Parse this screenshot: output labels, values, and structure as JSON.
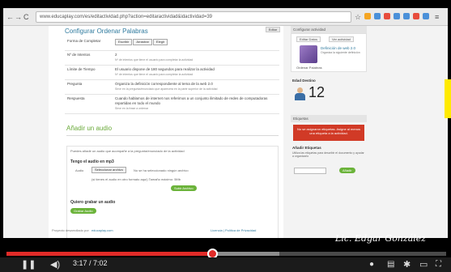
{
  "browser": {
    "url": "www.educaplay.com/es/editactividad.php?action=editaractividad&idactividad=39",
    "ext_colors": [
      "#f5a623",
      "#4a90d9",
      "#e74c3c",
      "#4a90d9",
      "#4a90d9",
      "#e74c3c",
      "#4a90d9"
    ]
  },
  "main": {
    "title": "Configurar Ordenar Palabras",
    "top_button": "Editar",
    "rows": [
      {
        "label": "Forma de Completar",
        "buttons": [
          "Escribir",
          "Arrastrar",
          "Elegir"
        ],
        "hint": ""
      },
      {
        "label": "Nº de Intentos",
        "value": "2",
        "hint": "Nº de intentos que tiene el usuario para completar la actividad"
      },
      {
        "label": "Límite de Tiempo",
        "value": "El usuario dispone de 180 segundos para realizar la actividad",
        "hint": "Nº de intentos que tiene el usuario para completar la actividad"
      },
      {
        "label": "Pregunta",
        "value": "Organiza la definición correspondiente al tema de la web 2.0",
        "hint": "Sirve en la pregunta/enunciado que aparecerá en la parte superior de la actividad"
      },
      {
        "label": "Respuesta",
        "value": "Cuando hablamos de internet nos referimos a un conjunto ilimitado de redes de computadoras repartidas en todo el mundo",
        "hint": "Sirve en la frase a ordenar"
      }
    ],
    "audio_title": "Añadir un audio",
    "audio_note": "Puedes añadir un audio que acompañe a la pregunta/enunciado de la actividad",
    "mp3_title": "Tengo el audio en mp3",
    "audio_label": "Audio",
    "select_file_label": "Seleccionar archivo",
    "no_file_text": "No se ha seleccionado ningún archivo",
    "file_limit": "(si tienes el audio en otro formato aquí)   Tamaño máximo: 5Mb",
    "upload_button": "Subir Archivo",
    "record_title": "Quiero grabar un audio",
    "record_button": "Grabar Audio",
    "footer_text": "Proyecto desarrollado por",
    "footer_link": "educaplay.com",
    "footer_right": "Licencia  |  Política de Privacidad"
  },
  "sidebar": {
    "config_head": "Configurar actividad",
    "view_button": "Editar Datos",
    "edit_button": "Ver actividad",
    "activity_title": "Definición de web 2.0",
    "activity_sub": "Organiza la siguiente definición",
    "activity_type": "Ordenar Palabras",
    "age_label": "Edad Destino",
    "age_value": "12",
    "tags_head": "Etiquetas",
    "tags_alert": "No se asignaron etiquetas. Asigne al menos una etiqueta a la actividad.",
    "add_tags_title": "Añadir Etiquetas",
    "add_tags_hint": "Utiliza las etiquetas para describir el documento y ayudar a organizarlo",
    "add_tags_button": "Añadir"
  },
  "player": {
    "watermark": "Lic. Edgar González",
    "current_time": "3:17",
    "duration": "7:02",
    "played_fraction": 0.467,
    "buffered_fraction": 0.62,
    "accent": "#e12b28"
  }
}
